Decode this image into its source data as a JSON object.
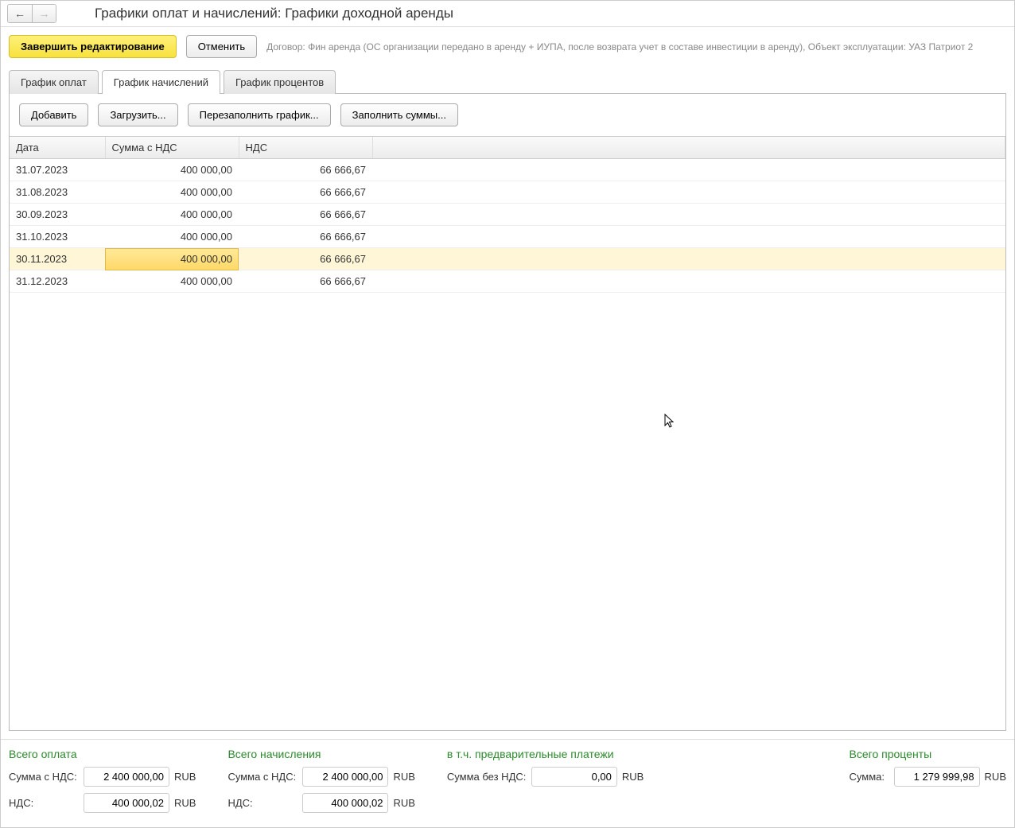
{
  "title": "Графики оплат и начислений: Графики доходной аренды",
  "nav": {
    "back_disabled": false,
    "fwd_disabled": true
  },
  "actions": {
    "finish": "Завершить редактирование",
    "cancel": "Отменить"
  },
  "subtext": "Договор: Фин аренда (ОС организации передано в аренду + ИУПА, после возврата учет в составе инвестиции в аренду), Объект эксплуатации: УАЗ Патриот 2",
  "tabs": {
    "active_index": 1,
    "items": [
      "График оплат",
      "График начислений",
      "График процентов"
    ]
  },
  "toolbar": {
    "add": "Добавить",
    "load": "Загрузить...",
    "refill": "Перезаполнить график...",
    "fill_sums": "Заполнить суммы..."
  },
  "table": {
    "headers": {
      "date": "Дата",
      "sum": "Сумма с НДС",
      "nds": "НДС"
    },
    "selected_index": 4,
    "selected_col": 1,
    "rows": [
      {
        "date": "31.07.2023",
        "sum": "400 000,00",
        "nds": "66 666,67"
      },
      {
        "date": "31.08.2023",
        "sum": "400 000,00",
        "nds": "66 666,67"
      },
      {
        "date": "30.09.2023",
        "sum": "400 000,00",
        "nds": "66 666,67"
      },
      {
        "date": "31.10.2023",
        "sum": "400 000,00",
        "nds": "66 666,67"
      },
      {
        "date": "30.11.2023",
        "sum": "400 000,00",
        "nds": "66 666,67"
      },
      {
        "date": "31.12.2023",
        "sum": "400 000,00",
        "nds": "66 666,67"
      }
    ]
  },
  "footer": {
    "currency": "RUB",
    "total_pay": {
      "title": "Всего оплата",
      "sum_label": "Сумма с НДС:",
      "sum": "2 400 000,00",
      "nds_label": "НДС:",
      "nds": "400 000,02"
    },
    "total_accrual": {
      "title": "Всего начисления",
      "sum_label": "Сумма с НДС:",
      "sum": "2 400 000,00",
      "nds_label": "НДС:",
      "nds": "400 000,02"
    },
    "prepay": {
      "title": "в т.ч. предварительные платежи",
      "sum_label": "Сумма без НДС:",
      "sum": "0,00"
    },
    "total_interest": {
      "title": "Всего проценты",
      "sum_label": "Сумма:",
      "sum": "1 279 999,98"
    }
  }
}
